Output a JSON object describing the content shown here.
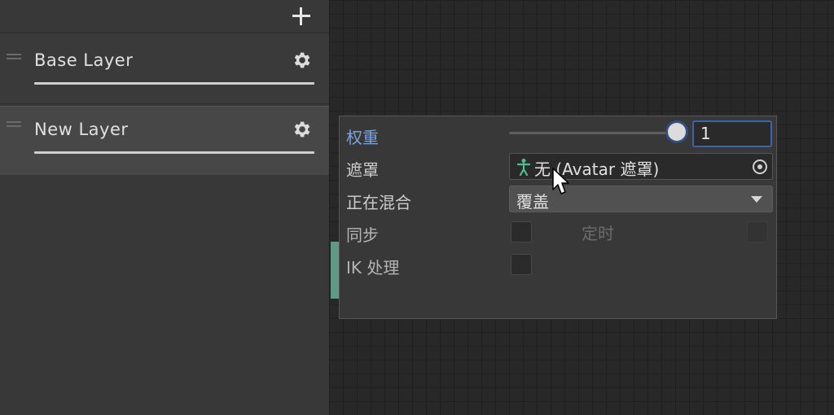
{
  "layers": [
    {
      "name": "Base Layer"
    },
    {
      "name": "New Layer"
    }
  ],
  "settings": {
    "weight": {
      "label": "权重",
      "value": "1",
      "slider_value": 1
    },
    "mask": {
      "label": "遮罩",
      "value": "无 (Avatar 遮罩)"
    },
    "blending": {
      "label": "正在混合",
      "value": "覆盖"
    },
    "sync": {
      "label": "同步",
      "timing_label": "定时"
    },
    "ik_pass": {
      "label": "IK 处理"
    }
  },
  "colors": {
    "accent": "#3c64a8",
    "active_label": "#7aa2e0",
    "layer_accent": "#5f9a86"
  },
  "icons": [
    "plus-icon",
    "drag-handle-icon",
    "gear-icon",
    "avatar-icon",
    "object-picker-icon",
    "dropdown-caret-icon",
    "mouse-cursor-icon"
  ]
}
